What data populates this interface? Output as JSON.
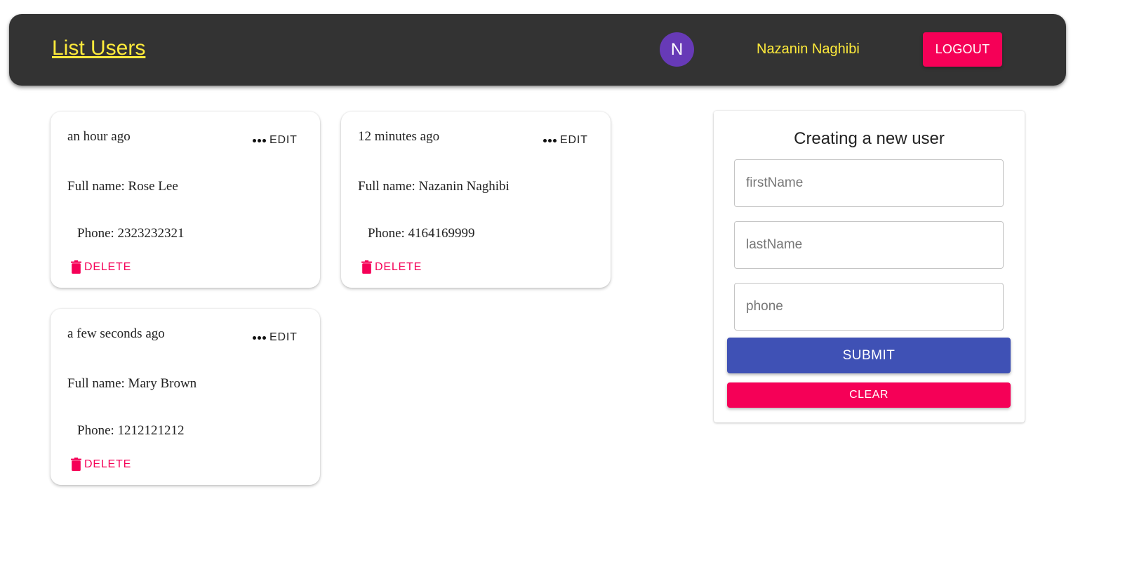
{
  "header": {
    "title": "List Users",
    "avatar_initial": "N",
    "user_name": "Nazanin Naghibi",
    "logout_label": "LOGOUT"
  },
  "colors": {
    "appbar_bg": "#333333",
    "accent_yellow": "#ffeb3b",
    "avatar_bg": "#673ab7",
    "secondary": "#f50057",
    "primary": "#3f51b5"
  },
  "icons": {
    "more": "more-horiz-icon",
    "delete": "trash-icon"
  },
  "users": [
    {
      "time": "an hour ago",
      "edit_label": "EDIT",
      "full_name": "Full name: Rose Lee",
      "phone": "Phone: 2323232321",
      "delete_label": "DELETE"
    },
    {
      "time": "12 minutes ago",
      "edit_label": "EDIT",
      "full_name": "Full name: Nazanin Naghibi",
      "phone": "Phone: 4164169999",
      "delete_label": "DELETE"
    },
    {
      "time": "a few seconds ago",
      "edit_label": "EDIT",
      "full_name": "Full name: Mary Brown",
      "phone": "Phone: 1212121212",
      "delete_label": "DELETE"
    }
  ],
  "form": {
    "title": "Creating a new user",
    "first_name": {
      "placeholder": "firstName",
      "value": ""
    },
    "last_name": {
      "placeholder": "lastName",
      "value": ""
    },
    "phone": {
      "placeholder": "phone",
      "value": ""
    },
    "submit_label": "SUBMIT",
    "clear_label": "CLEAR"
  }
}
